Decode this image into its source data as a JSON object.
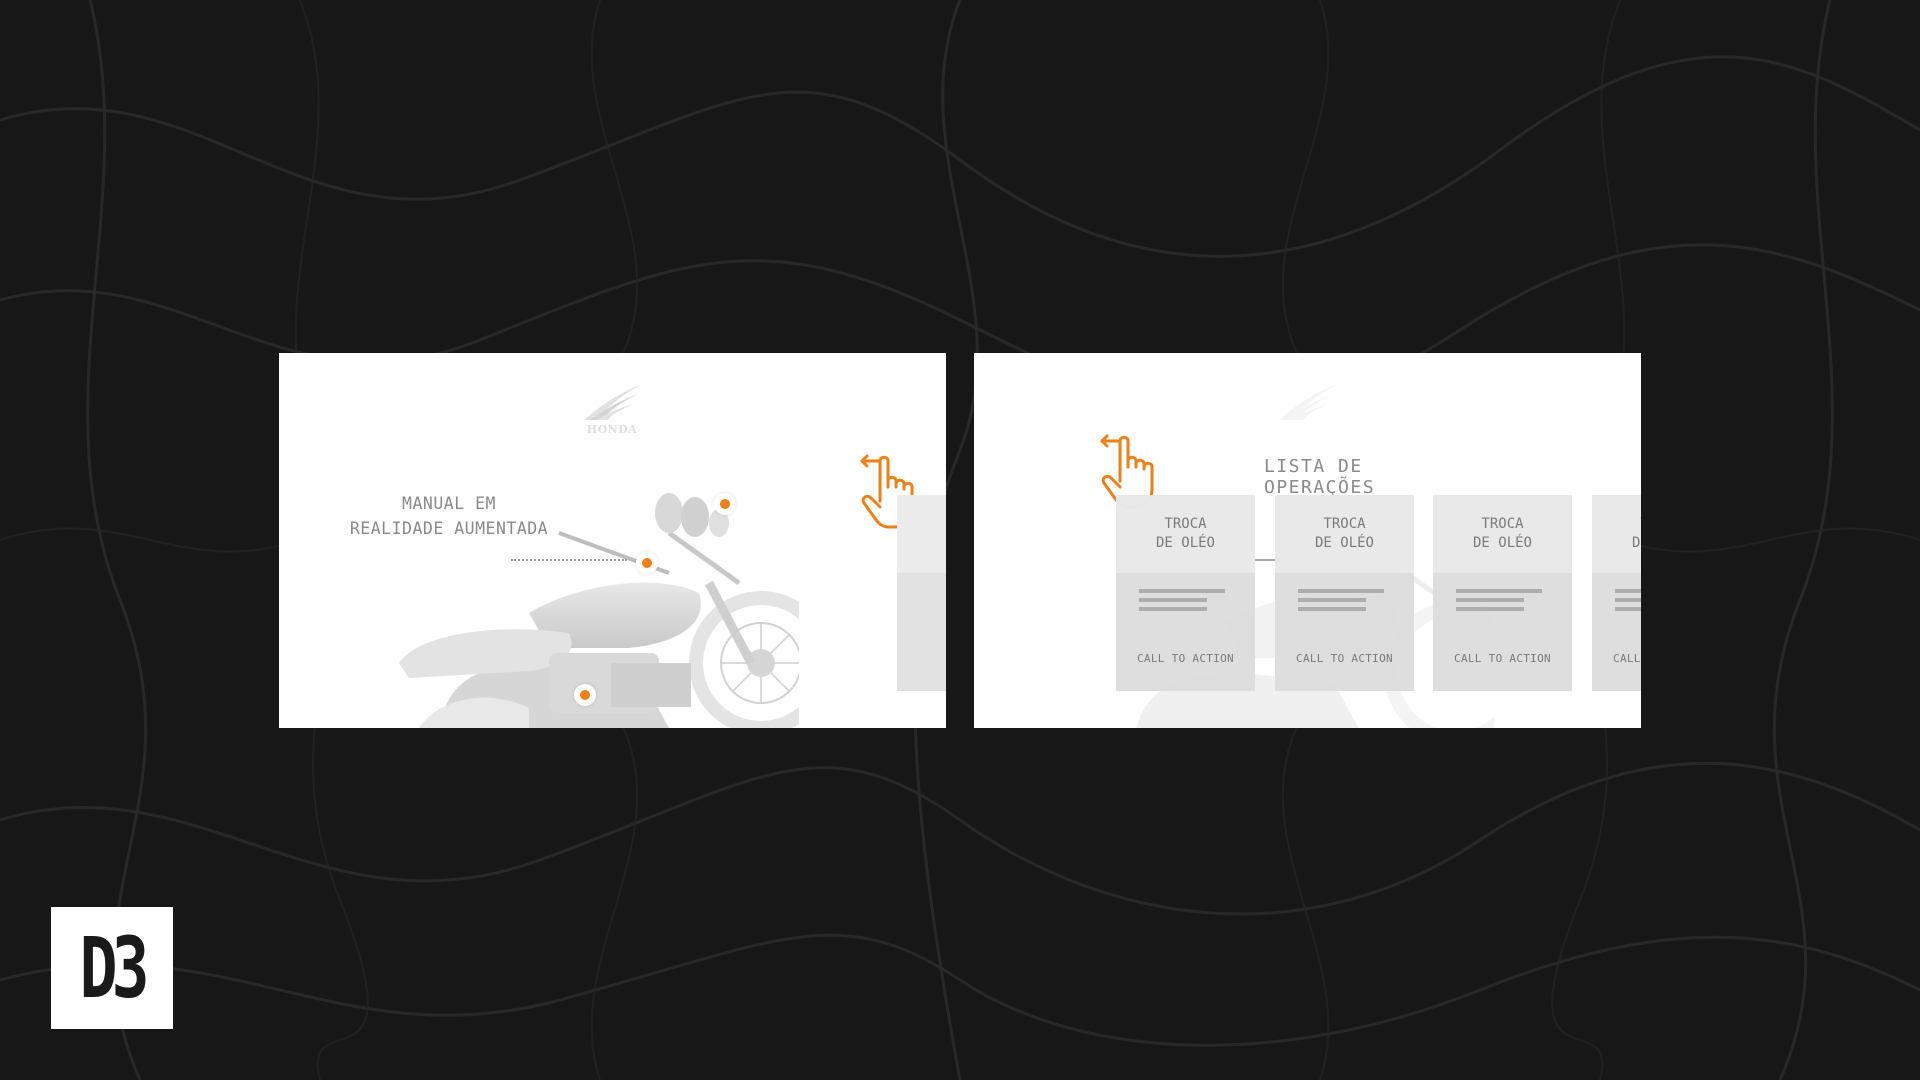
{
  "brand": {
    "badge_text": "D3",
    "logo_text": "HONDA"
  },
  "colors": {
    "accent": "#f07f16",
    "background": "#161616",
    "card": "#dadada"
  },
  "screen_left": {
    "title": "MANUAL EM\nREALIDADE AUMENTADA",
    "icons": [
      "honda-wing-logo",
      "swipe-left-hand-icon",
      "motorcycle-model"
    ]
  },
  "screen_right": {
    "title": "LISTA DE OPERAÇÕES",
    "cards": [
      {
        "title": "TROCA\nDE OLÉO",
        "cta": "CALL TO ACTION"
      },
      {
        "title": "TROCA\nDE OLÉO",
        "cta": "CALL TO ACTION"
      },
      {
        "title": "TROCA\nDE OLÉO",
        "cta": "CALL TO ACTION"
      },
      {
        "title": "TROCA\nDE OLÉO",
        "cta": "CALL TO ACTION"
      }
    ]
  }
}
